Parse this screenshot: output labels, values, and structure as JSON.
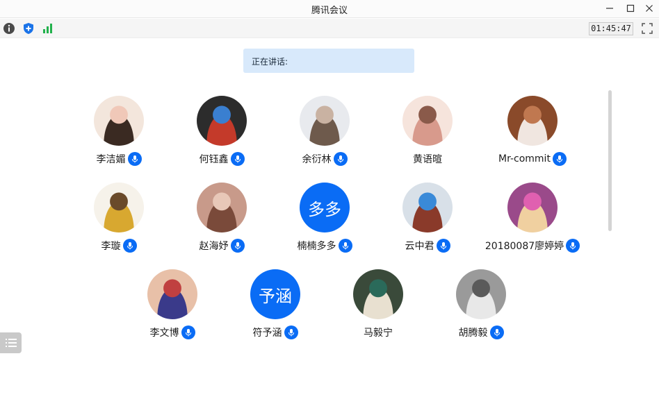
{
  "window": {
    "title": "腾讯会议"
  },
  "toolbar": {
    "timer": "01:45:47"
  },
  "speaking": {
    "label": "正在讲话:"
  },
  "participants": [
    {
      "name": "李洁媚",
      "avatar": "photo",
      "palette": [
        "#f3e6dc",
        "#3a2a22",
        "#f0c8b8"
      ],
      "mic": true
    },
    {
      "name": "何钰鑫",
      "avatar": "photo",
      "palette": [
        "#2c2c2c",
        "#c43a2a",
        "#3a7fd0"
      ],
      "mic": true
    },
    {
      "name": "余衍林",
      "avatar": "photo",
      "palette": [
        "#e8eaee",
        "#6e5a4c",
        "#c9b2a2"
      ],
      "mic": true
    },
    {
      "name": "黄语暄",
      "avatar": "photo",
      "palette": [
        "#f6e4dc",
        "#d89a8c",
        "#8a5a4a"
      ],
      "mic": false
    },
    {
      "name": "Mr-commit",
      "avatar": "photo",
      "palette": [
        "#8a4a2a",
        "#f0e6e0",
        "#c07850"
      ],
      "mic": true
    },
    {
      "name": "李璇",
      "avatar": "photo",
      "palette": [
        "#f6f2ea",
        "#d8a830",
        "#6a4a2a"
      ],
      "mic": true
    },
    {
      "name": "赵海妤",
      "avatar": "photo",
      "palette": [
        "#c89a8a",
        "#7a4a3a",
        "#e8c8b8"
      ],
      "mic": true
    },
    {
      "name": "楠楠多多",
      "avatar": "text",
      "avatar_text": "多多",
      "mic": true
    },
    {
      "name": "云中君",
      "avatar": "photo",
      "palette": [
        "#d8e0e8",
        "#8a3a2a",
        "#3a8ad8"
      ],
      "mic": true
    },
    {
      "name": "20180087廖婷婷",
      "avatar": "photo",
      "palette": [
        "#9a4a8a",
        "#f0d0a0",
        "#e060b0"
      ],
      "mic": true
    },
    {
      "name": "李文博",
      "avatar": "photo",
      "palette": [
        "#e8c0a8",
        "#3a3a8a",
        "#c04040"
      ],
      "mic": true
    },
    {
      "name": "符予涵",
      "avatar": "text",
      "avatar_text": "予涵",
      "mic": true
    },
    {
      "name": "马毅宁",
      "avatar": "photo",
      "palette": [
        "#3a4a3a",
        "#e8e0d0",
        "#2a6a5a"
      ],
      "mic": false
    },
    {
      "name": "胡腾毅",
      "avatar": "photo",
      "palette": [
        "#9a9a9a",
        "#e8e8e8",
        "#5a5a5a"
      ],
      "mic": true
    }
  ],
  "colors": {
    "accent": "#0a6cf5",
    "speaking_bg": "#d8e9fb",
    "titlebar_bg": "#fbfbfb"
  },
  "icons": [
    "info-icon",
    "security-shield-icon",
    "network-signal-icon",
    "fullscreen-icon",
    "microphone-icon",
    "participant-list-icon",
    "minimize-icon",
    "maximize-icon",
    "close-icon"
  ]
}
